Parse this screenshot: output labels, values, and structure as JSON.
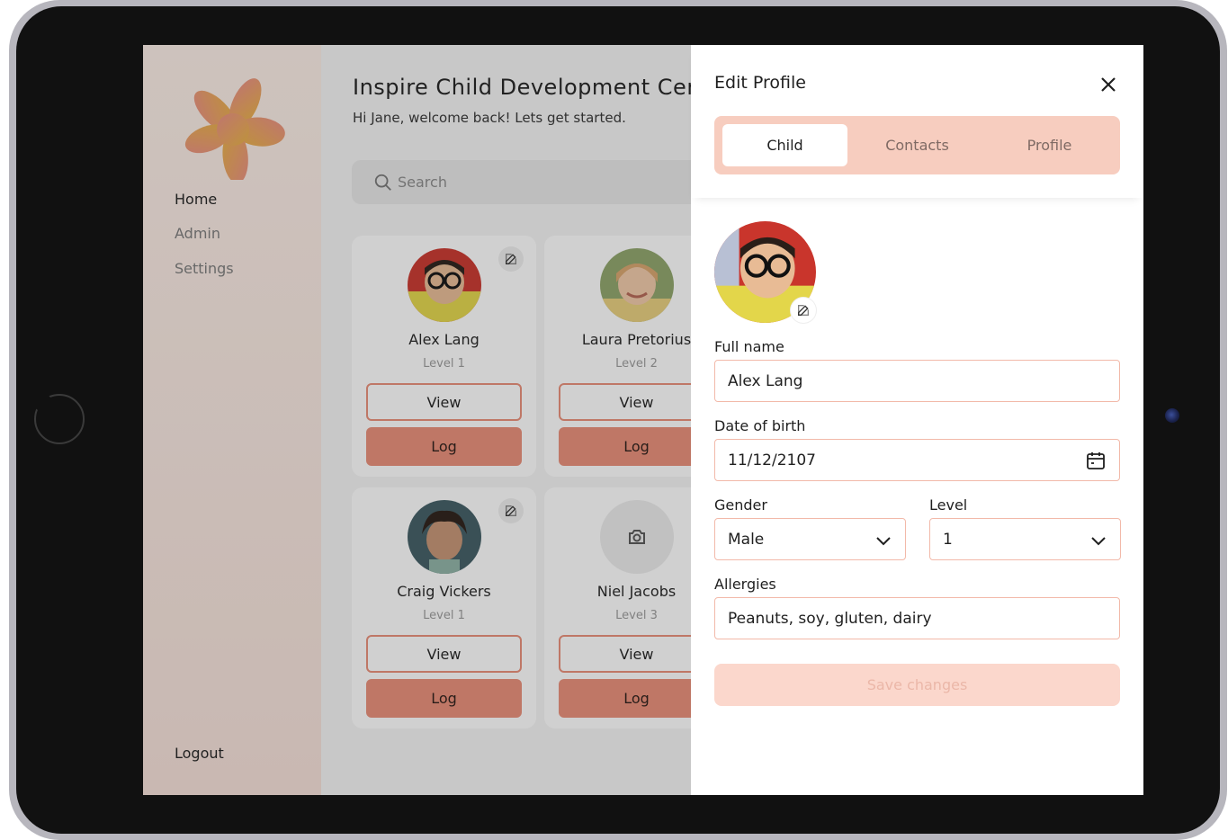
{
  "app": {
    "title": "Inspire Child Development Cent",
    "greeting": "Hi Jane, welcome back! Lets get started."
  },
  "sidebar": {
    "items": [
      {
        "label": "Home",
        "active": true
      },
      {
        "label": "Admin",
        "active": false
      },
      {
        "label": "Settings",
        "active": false
      }
    ],
    "logout": "Logout"
  },
  "search": {
    "placeholder": "Search"
  },
  "children": [
    {
      "name": "Alex Lang",
      "level": "Level 1",
      "view": "View",
      "log": "Log",
      "avatar": "boy-glasses"
    },
    {
      "name": "Laura Pretorius",
      "level": "Level 2",
      "view": "View",
      "log": "Log",
      "avatar": "girl-blonde"
    },
    {
      "name": "Craig Vickers",
      "level": "Level 1",
      "view": "View",
      "log": "Log",
      "avatar": "boy-curly"
    },
    {
      "name": "Niel Jacobs",
      "level": "Level 3",
      "view": "View",
      "log": "Log",
      "avatar": "camera-placeholder"
    }
  ],
  "panel": {
    "title": "Edit Profile",
    "tabs": [
      "Child",
      "Contacts",
      "Profile"
    ],
    "active_tab": "Child",
    "fields": {
      "full_name_label": "Full name",
      "full_name": "Alex Lang",
      "dob_label": "Date of birth",
      "dob": "11/12/2107",
      "gender_label": "Gender",
      "gender": "Male",
      "level_label": "Level",
      "level": "1",
      "allergies_label": "Allergies",
      "allergies": "Peanuts, soy, gluten, dairy"
    },
    "save_label": "Save changes"
  },
  "colors": {
    "accent": "#e98e78",
    "tab_bg": "#f7cdbf",
    "field_border": "#f2b9a9",
    "save_disabled": "#fbd7cc"
  }
}
